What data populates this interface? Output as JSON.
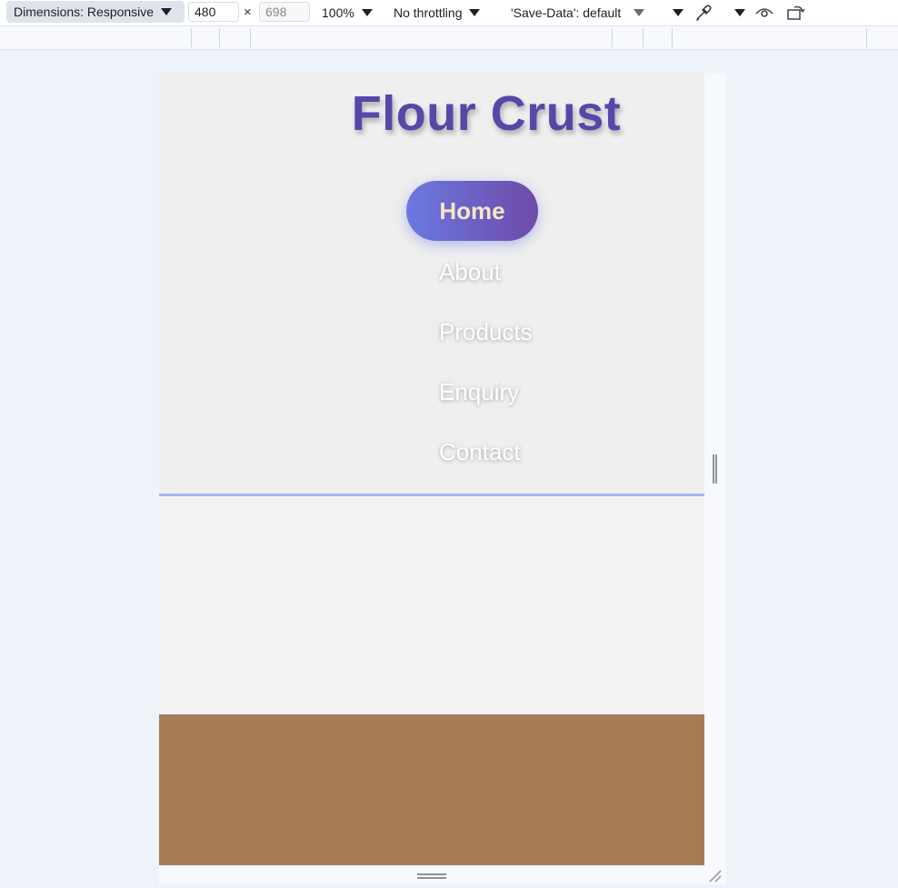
{
  "toolbar": {
    "dimensions_label": "Dimensions: Responsive",
    "width_value": "480",
    "times_sign": "×",
    "height_placeholder": "698",
    "zoom_label": "100%",
    "throttling_label": "No throttling",
    "save_data_label": "'Save-Data': default"
  },
  "site": {
    "brand": "Flour Crust",
    "nav": [
      "Home",
      "About",
      "Products",
      "Enquiry",
      "Contact"
    ]
  },
  "colors": {
    "footer": "#a87b57",
    "nav_active_start": "#6a79e0",
    "nav_active_end": "#6f4aa9",
    "brand": "#5548a8",
    "nav_active_text": "#f6e7c8"
  }
}
